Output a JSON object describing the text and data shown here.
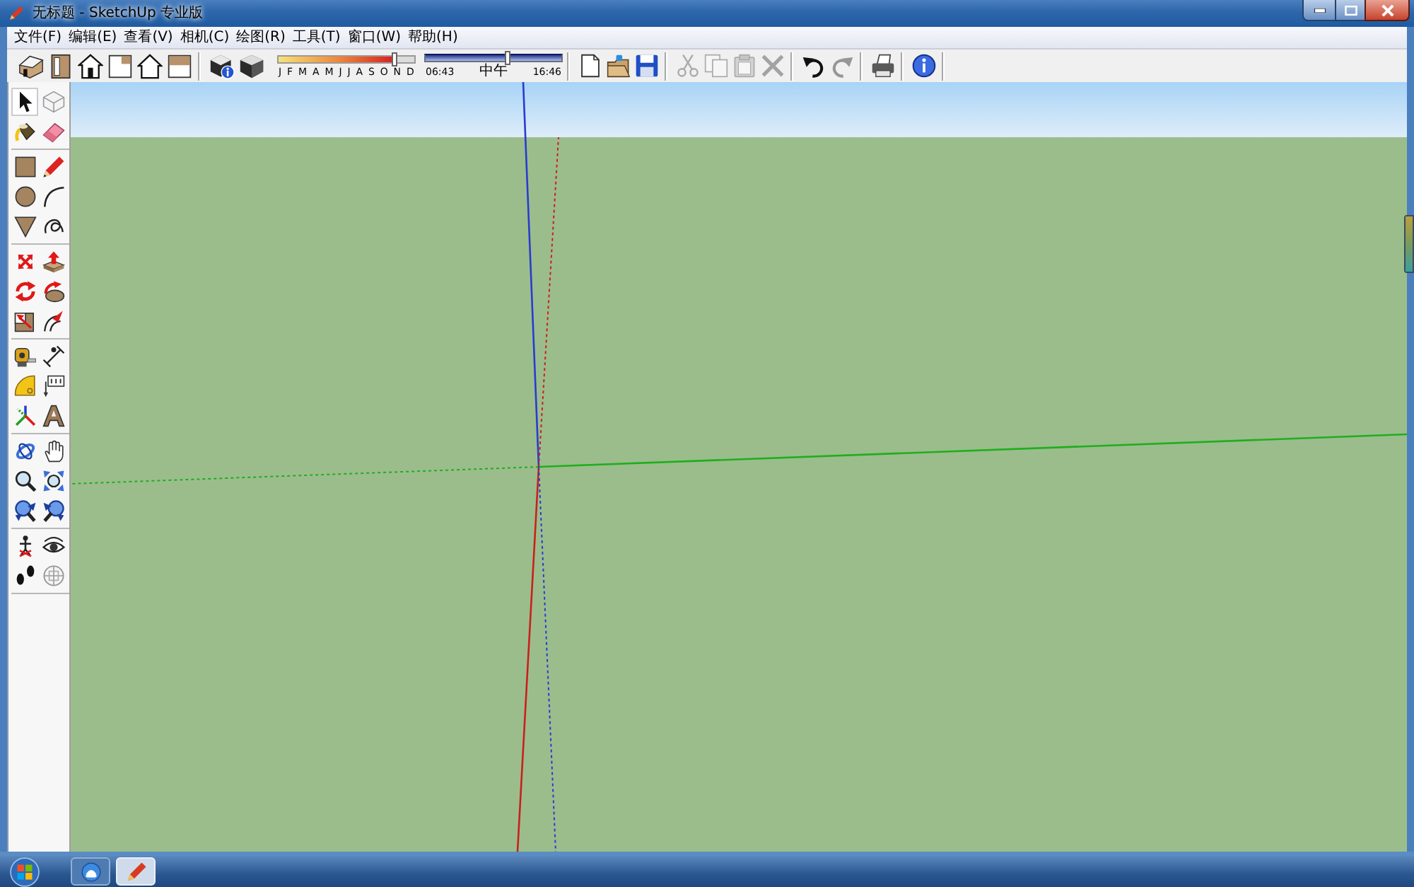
{
  "window": {
    "title": "无标题 - SketchUp 专业版"
  },
  "menu": [
    "文件(F)",
    "编辑(E)",
    "查看(V)",
    "相机(C)",
    "绘图(R)",
    "工具(T)",
    "窗口(W)",
    "帮助(H)"
  ],
  "views_toolbar": [
    {
      "kind": "iso"
    },
    {
      "kind": "top"
    },
    {
      "kind": "front"
    },
    {
      "kind": "right"
    },
    {
      "kind": "back"
    },
    {
      "kind": "left"
    }
  ],
  "shadow_toolbar": {
    "buttons": [
      {
        "kind": "shadows"
      },
      {
        "kind": "fog"
      }
    ],
    "months": [
      "J",
      "F",
      "M",
      "A",
      "M",
      "J",
      "J",
      "A",
      "S",
      "O",
      "N",
      "D"
    ],
    "date_slider": {
      "level": 0.85
    },
    "time_start": "06:43",
    "time_noon": "中午",
    "time_end": "16:46",
    "time_slider": {
      "level": 0.6
    }
  },
  "standard_toolbar": [
    {
      "buttons": [
        {
          "kind": "new",
          "disabled": false
        },
        {
          "kind": "open",
          "disabled": false
        },
        {
          "kind": "save",
          "disabled": false
        }
      ]
    },
    {
      "buttons": [
        {
          "kind": "cut",
          "disabled": true
        },
        {
          "kind": "copy",
          "disabled": true
        },
        {
          "kind": "paste",
          "disabled": true
        },
        {
          "kind": "erase",
          "disabled": true
        }
      ]
    },
    {
      "buttons": [
        {
          "kind": "undo",
          "disabled": false
        },
        {
          "kind": "redo",
          "disabled": true
        }
      ]
    },
    {
      "buttons": [
        {
          "kind": "print",
          "disabled": false
        }
      ]
    },
    {
      "buttons": [
        {
          "kind": "info",
          "disabled": false
        }
      ]
    }
  ],
  "tools": [
    {
      "buttons": [
        {
          "kind": "select",
          "selected": true
        },
        {
          "kind": "component",
          "selected": false
        },
        {
          "kind": "paint",
          "selected": false
        },
        {
          "kind": "eraser",
          "selected": false
        }
      ]
    },
    {
      "buttons": [
        {
          "kind": "rectangle",
          "selected": false
        },
        {
          "kind": "line",
          "selected": false
        },
        {
          "kind": "circle",
          "selected": false
        },
        {
          "kind": "arc",
          "selected": false
        },
        {
          "kind": "polygon",
          "selected": false
        },
        {
          "kind": "freehand",
          "selected": false
        }
      ]
    },
    {
      "buttons": [
        {
          "kind": "move",
          "selected": false
        },
        {
          "kind": "pushpull",
          "selected": false
        },
        {
          "kind": "rotate",
          "selected": false
        },
        {
          "kind": "followme",
          "selected": false
        },
        {
          "kind": "scale",
          "selected": false
        },
        {
          "kind": "offset",
          "selected": false
        }
      ]
    },
    {
      "buttons": [
        {
          "kind": "tape",
          "selected": false
        },
        {
          "kind": "dimension",
          "selected": false
        },
        {
          "kind": "protractor",
          "selected": false
        },
        {
          "kind": "text",
          "selected": false
        },
        {
          "kind": "axes",
          "selected": false
        },
        {
          "kind": "text3d",
          "selected": false
        }
      ]
    },
    {
      "buttons": [
        {
          "kind": "orbit",
          "selected": false
        },
        {
          "kind": "pan",
          "selected": false
        },
        {
          "kind": "zoom",
          "selected": false
        },
        {
          "kind": "zoomwindow",
          "selected": false
        },
        {
          "kind": "zoomextents",
          "selected": false
        },
        {
          "kind": "previous",
          "selected": false
        }
      ]
    },
    {
      "buttons": [
        {
          "kind": "position",
          "selected": false
        },
        {
          "kind": "look",
          "selected": false
        },
        {
          "kind": "walk",
          "selected": false
        },
        {
          "kind": "section",
          "selected": false
        }
      ]
    }
  ],
  "taskbar": {
    "buttons": [
      {
        "kind": "browser",
        "selected": false
      },
      {
        "kind": "sketchup",
        "selected": true
      }
    ]
  }
}
